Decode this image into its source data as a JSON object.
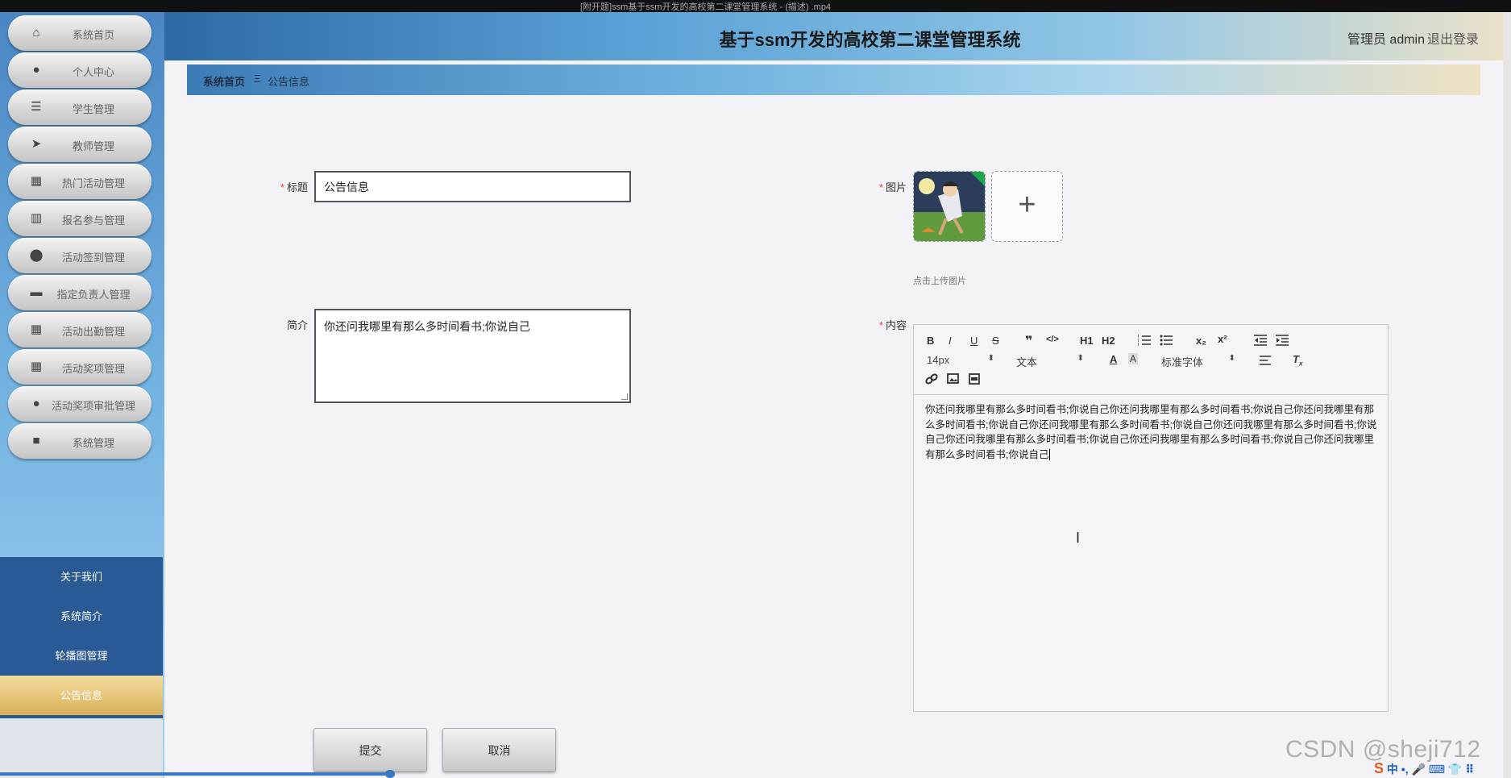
{
  "window": {
    "title": "[附开题]ssm基于ssm开发的高校第二课堂管理系统 - (描述) .mp4"
  },
  "header": {
    "title": "基于ssm开发的高校第二课堂管理系统",
    "user": "管理员 admin",
    "logout": "退出登录"
  },
  "sidebar": {
    "items": [
      {
        "label": "系统首页",
        "icon": "home-icon",
        "glyph": "⌂"
      },
      {
        "label": "个人中心",
        "icon": "user-icon",
        "glyph": "●"
      },
      {
        "label": "学生管理",
        "icon": "list-icon",
        "glyph": "☰"
      },
      {
        "label": "教师管理",
        "icon": "send-icon",
        "glyph": "➤"
      },
      {
        "label": "热门活动管理",
        "icon": "grid-icon",
        "glyph": "▦"
      },
      {
        "label": "报名参与管理",
        "icon": "books-icon",
        "glyph": "▥"
      },
      {
        "label": "活动签到管理",
        "icon": "location-icon",
        "glyph": "⬤"
      },
      {
        "label": "指定负责人管理",
        "icon": "monitor-icon",
        "glyph": "▬"
      },
      {
        "label": "活动出勤管理",
        "icon": "grid-icon",
        "glyph": "▦"
      },
      {
        "label": "活动奖项管理",
        "icon": "grid-icon",
        "glyph": "▦"
      },
      {
        "label": "活动奖项审批管理",
        "icon": "user-icon",
        "glyph": "●"
      },
      {
        "label": "系统管理",
        "icon": "video-icon",
        "glyph": "■"
      }
    ],
    "sub_items": [
      {
        "label": "关于我们"
      },
      {
        "label": "系统简介"
      },
      {
        "label": "轮播图管理"
      },
      {
        "label": "公告信息",
        "active": true
      }
    ]
  },
  "breadcrumb": {
    "home": "系统首页",
    "separator": "Ξ",
    "current": "公告信息"
  },
  "form": {
    "title_label": "标题",
    "title_value": "公告信息",
    "image_label": "图片",
    "upload_tip": "点击上传图片",
    "intro_label": "简介",
    "intro_value": "你还问我哪里有那么多时间看书;你说自己",
    "content_label": "内容",
    "content_value": "你还问我哪里有那么多时间看书;你说自己你还问我哪里有那么多时间看书;你说自己你还问我哪里有那么多时间看书;你说自己你还问我哪里有那么多时间看书;你说自己你还问我哪里有那么多时间看书;你说自己你还问我哪里有那么多时间看书;你说自己你还问我哪里有那么多时间看书;你说自己你还问我哪里有那么多时间看书;你说自己",
    "submit": "提交",
    "cancel": "取消"
  },
  "editor_toolbar": {
    "font_size": "14px",
    "text_type": "文本",
    "font_family": "标准字体",
    "buttons": [
      "B",
      "I",
      "U",
      "S",
      "❞",
      "</>",
      "H1",
      "H2",
      "ol",
      "ul",
      "x₂",
      "x²",
      "outdent",
      "indent"
    ]
  },
  "watermark": "CSDN @sheji712",
  "ime": {
    "label": "中"
  },
  "colors": {
    "accent": "#2a5a95",
    "active": "#d9b05a",
    "required": "#ee3333"
  }
}
